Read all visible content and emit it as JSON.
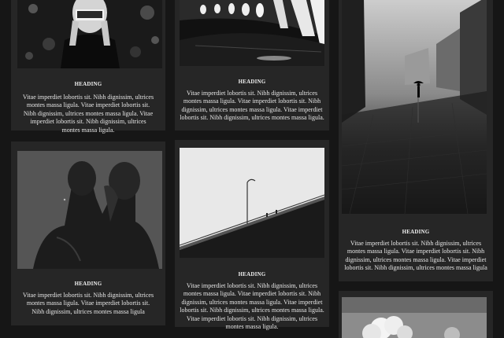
{
  "cards": [
    {
      "heading": "HEADING",
      "body": "Vitae imperdiet lobortis sit. Nibh dignissim, ultrices montes massa ligula. Vitae imperdiet lobortis sit. Nibh dignissim, ultrices montes massa ligula. Vitae imperdiet lobortis sit. Nibh dignissim, ultrices montes massa ligula."
    },
    {
      "heading": "HEADING",
      "body": "Vitae imperdiet lobortis sit. Nibh dignissim, ultrices montes massa ligula. Vitae imperdiet lobortis sit. Nibh dignissim, ultrices montes massa ligula. Vitae imperdiet lobortis sit. Nibh dignissim, ultrices montes massa ligula."
    },
    {
      "heading": "HEADING",
      "body": "Vitae imperdiet lobortis sit. Nibh dignissim, ultrices montes massa ligula. Vitae imperdiet lobortis sit. Nibh dignissim, ultrices montes massa ligula. Vitae imperdiet lobortis sit. Nibh dignissim, ultrices montes massa ligula"
    },
    {
      "heading": "HEADING",
      "body": "Vitae imperdiet lobortis sit. Nibh dignissim, ultrices montes massa ligula. Vitae imperdiet lobortis sit. Nibh dignissim, ultrices montes massa ligula"
    },
    {
      "heading": "HEADING",
      "body": "Vitae imperdiet lobortis sit. Nibh dignissim, ultrices montes massa ligula. Vitae imperdiet lobortis sit. Nibh dignissim, ultrices montes massa ligula. Vitae imperdiet lobortis sit. Nibh dignissim, ultrices montes massa ligula. Vitae imperdiet lobortis sit. Nibh dignissim, ultrices montes massa ligula."
    }
  ]
}
